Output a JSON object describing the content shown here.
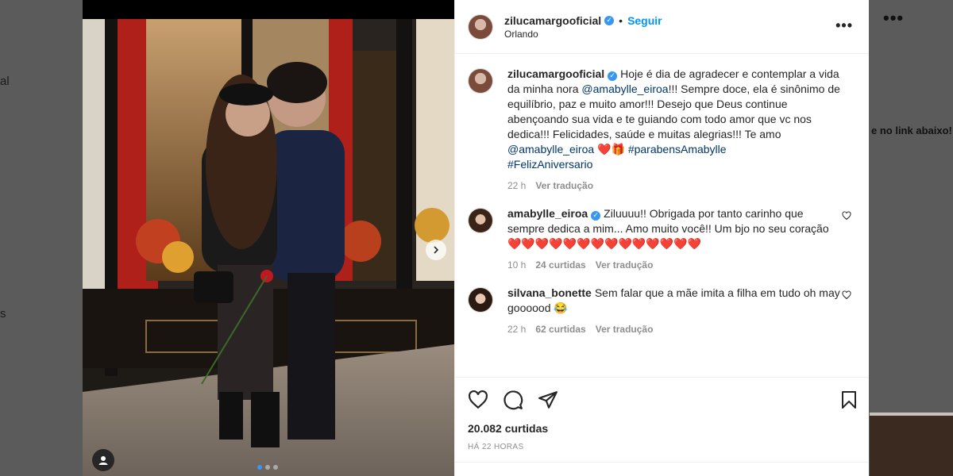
{
  "background": {
    "left_fragments": [
      "al",
      "s"
    ],
    "right_text": "e no link abaixo!",
    "right_dots": "•••"
  },
  "post": {
    "author": "zilucamargooficial",
    "verified_icon": "verified-badge-icon",
    "separator": "•",
    "follow_label": "Seguir",
    "location": "Orlando",
    "more_label": "•••",
    "caption": {
      "username": "zilucamargooficial",
      "text_1": "Hoje é dia de agradecer e contemplar a vida da minha nora ",
      "mention_1": "@amabylle_eiroa",
      "text_2": "!!! Sempre doce, ela é sinônimo de equilíbrio, paz e muito amor!!! Desejo que Deus continue abençoando sua vida e te guiando com todo amor que vc nos dedica!!! Felicidades, saúde e muitas alegrias!!! Te amo ",
      "mention_2": "@amabylle_eiroa",
      "emoji": " ❤️🎁 ",
      "hashtag_1": "#parabensAmabylle",
      "hashtag_2": "#FelizAniversario",
      "time": "22 h",
      "translate_label": "Ver tradução"
    },
    "comments": [
      {
        "username": "amabylle_eiroa",
        "verified": true,
        "text": "Ziluuuu!! Obrigada por tanto carinho que sempre dedica a mim... Amo muito você!! Um bjo no seu coração ❤️❤️❤️❤️❤️❤️❤️❤️❤️❤️❤️❤️❤️❤️",
        "time": "10 h",
        "likes": "24 curtidas",
        "translate_label": "Ver tradução"
      },
      {
        "username": "silvana_bonette",
        "verified": false,
        "text": "Sem falar que a mãe imita a filha em tudo oh may goooood 😂",
        "time": "22 h",
        "likes": "62 curtidas",
        "translate_label": "Ver tradução"
      }
    ],
    "likes_count": "20.082 curtidas",
    "posted_ago": "HÁ 22 HORAS",
    "icons": {
      "like": "heart-icon",
      "comment": "comment-icon",
      "share": "share-icon",
      "save": "bookmark-icon"
    }
  },
  "colors": {
    "follow": "#0095f6",
    "verified": "#3897f0",
    "link": "#00376b",
    "muted": "#8e8e8e"
  }
}
